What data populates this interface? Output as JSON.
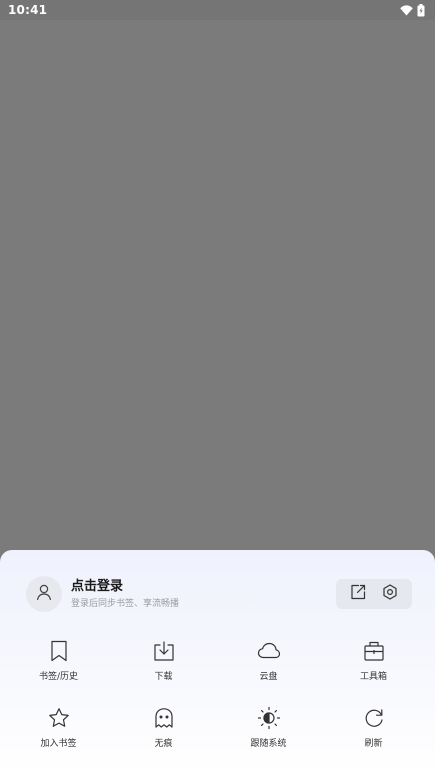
{
  "status_bar": {
    "time": "10:41",
    "icons": [
      "wifi-icon",
      "battery-icon"
    ]
  },
  "user": {
    "title": "点击登录",
    "subtitle": "登录后同步书签、享流畅播",
    "avatar_icon": "user-icon",
    "actions": [
      "edit-icon",
      "settings-icon"
    ]
  },
  "menu": {
    "row1": [
      {
        "label": "书签/历史",
        "icon": "bookmark-icon"
      },
      {
        "label": "下载",
        "icon": "download-icon"
      },
      {
        "label": "云盘",
        "icon": "cloud-icon"
      },
      {
        "label": "工具箱",
        "icon": "toolbox-icon"
      }
    ],
    "row2": [
      {
        "label": "加入书签",
        "icon": "star-icon"
      },
      {
        "label": "无痕",
        "icon": "ghost-icon"
      },
      {
        "label": "跟随系统",
        "icon": "theme-icon"
      },
      {
        "label": "刷新",
        "icon": "refresh-icon"
      }
    ]
  },
  "colors": {
    "overlay": "#7b7b7b",
    "sheet_top": "#eff2fd",
    "sheet_bottom": "#ffffff",
    "icon_stroke": "#333333"
  }
}
